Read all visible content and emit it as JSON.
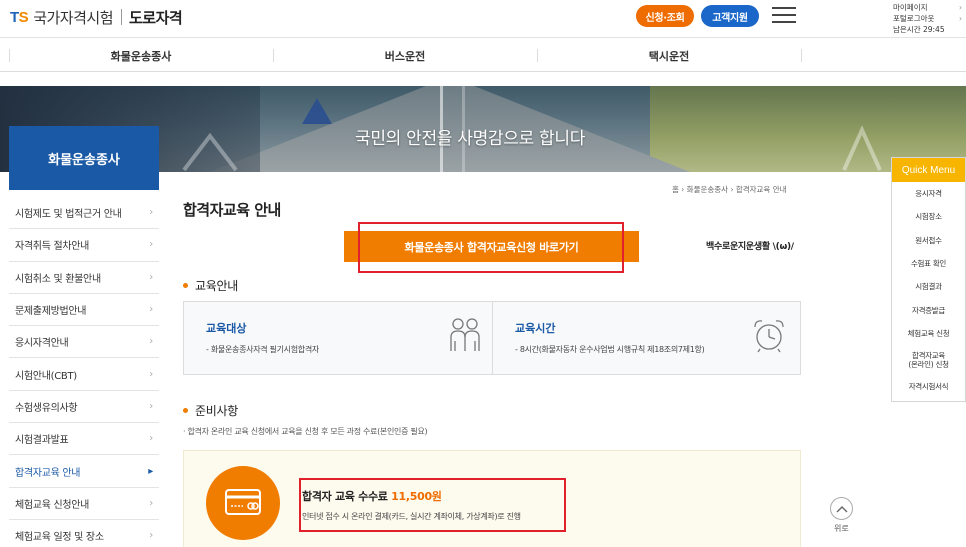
{
  "header": {
    "logo_ts": "TS",
    "logo_name": "국가자격시험",
    "logo_sub": "도로자격",
    "btn_apply": "신청·조회",
    "btn_support": "고객지원",
    "user_mypage": "마이페이지",
    "user_logout": "포털로그아웃",
    "user_timer": "남은시간 29:45"
  },
  "nav": {
    "items": [
      "화물운송종사",
      "버스운전",
      "택시운전"
    ]
  },
  "banner": {
    "slogan": "국민의 안전을 사명감으로 합니다"
  },
  "sidebar": {
    "title": "화물운송종사",
    "items": [
      "시험제도 및 법적근거 안내",
      "자격취득 절차안내",
      "시험취소 및 환불안내",
      "문제출제방법안내",
      "응시자격안내",
      "시험안내(CBT)",
      "수험생유의사항",
      "시험결과발표",
      "합격자교육 안내",
      "체험교육 신청안내",
      "체험교육 일정 및 장소"
    ],
    "active_index": 8
  },
  "main": {
    "breadcrumb": "홈 › 화물운송종사 › 합격자교육 안내",
    "page_title": "합격자교육 안내",
    "cta_label": "화물운송종사 합격자교육신청 바로가기",
    "slogan_small": "백수로운지운생활 \\(ω)/",
    "section1_title": "교육안내",
    "edu_target_title": "교육대상",
    "edu_target_desc": "- 화물운송종사자격 필기시험합격자",
    "edu_time_title": "교육시간",
    "edu_time_desc": "- 8시간(화물자동차 운수사업법 시행규칙 제18조의7제1항)",
    "section2_title": "준비사항",
    "prep_note": "· 합격자 온라인 교육 신청에서 교육을 신청 후 모든 과정 수료(본인인증 필요)",
    "fee_title": "합격자 교육 수수료",
    "fee_amount": "11,500원",
    "fee_desc": "인터넷 접수 시 온라인 결제(카드, 실시간 계좌이체, 가상계좌)로 진행"
  },
  "quick_menu": {
    "title": "Quick Menu",
    "items": [
      "응시자격",
      "시험장소",
      "원서접수",
      "수험표 확인",
      "시험결과",
      "자격증발급",
      "체험교육 신청",
      "합격자교육\n(온라인) 신청",
      "자격시험서식"
    ]
  },
  "top_button": {
    "label": "위로"
  },
  "colors": {
    "brand_blue": "#1a59a6",
    "accent_orange": "#f07c00",
    "highlight_red": "#e0202a",
    "quick_yellow": "#f7b500"
  }
}
